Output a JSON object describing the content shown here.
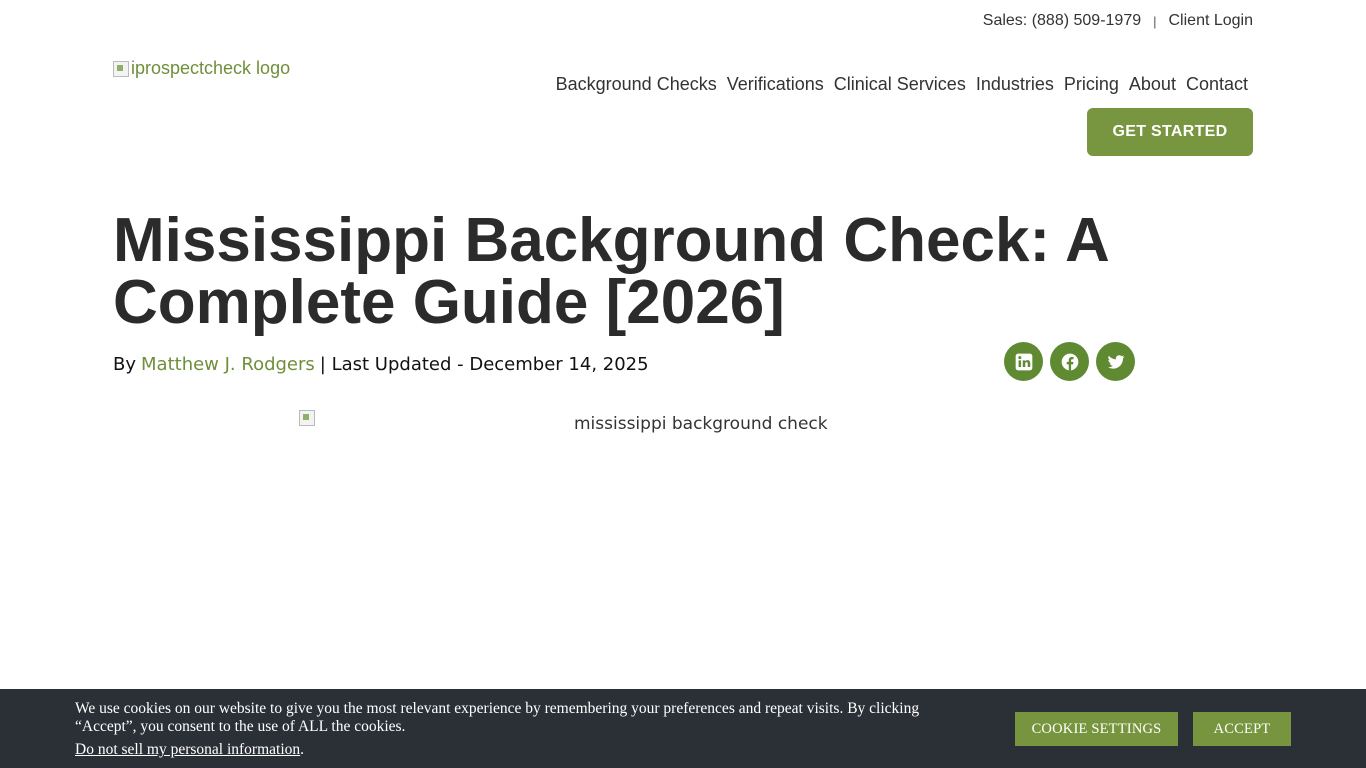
{
  "header": {
    "sales_label": "Sales: (888) 509-1979",
    "separator": "|",
    "client_login": "Client Login",
    "logo_alt": "iprospectcheck logo",
    "nav": [
      {
        "label": "Background Checks"
      },
      {
        "label": "Verifications"
      },
      {
        "label": "Clinical Services"
      },
      {
        "label": "Industries"
      },
      {
        "label": "Pricing"
      },
      {
        "label": "About"
      },
      {
        "label": "Contact"
      }
    ],
    "cta_label": "GET STARTED"
  },
  "article": {
    "title": "Mississippi Background Check: A Complete Guide [2026]",
    "by_prefix": "By",
    "author": "Matthew J. Rodgers",
    "updated_text": "| Last Updated - December 14, 2025",
    "hero_alt": "mississippi background check"
  },
  "share": {
    "icons": [
      "linkedin-icon",
      "facebook-icon",
      "twitter-icon"
    ],
    "color": "#5f8a32"
  },
  "cookie_banner": {
    "message": "We use cookies on our website to give you the most relevant experience by remembering your preferences and repeat visits. By clicking “Accept”, you consent to the use of ALL the cookies.",
    "do_not_sell": "Do not sell my personal information",
    "do_not_sell_suffix": ".",
    "settings_label": "COOKIE SETTINGS",
    "accept_label": "ACCEPT",
    "background": "#2b2f36",
    "button_color": "#77953f"
  },
  "colors": {
    "accent": "#78953f",
    "author_link": "#6f8f3a",
    "title_text": "#2b2b2b"
  }
}
